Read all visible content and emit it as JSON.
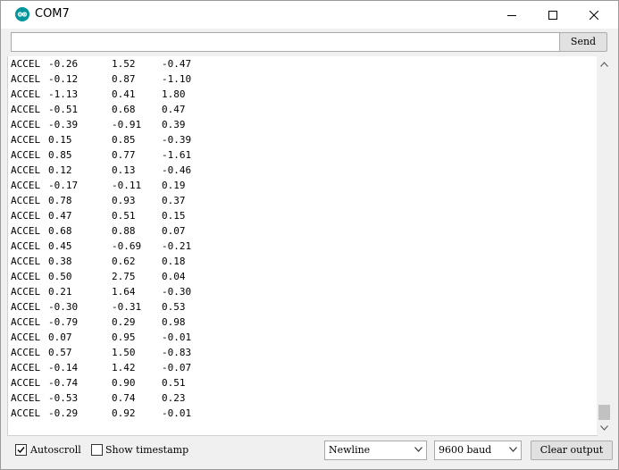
{
  "window": {
    "title": "COM7",
    "icon": "arduino-logo-icon"
  },
  "input": {
    "value": "",
    "placeholder": "",
    "send_label": "Send"
  },
  "output": {
    "lines": [
      [
        "ACCEL",
        "-0.26",
        "1.52",
        "-0.47"
      ],
      [
        "ACCEL",
        "-0.12",
        "0.87",
        "-1.10"
      ],
      [
        "ACCEL",
        "-1.13",
        "0.41",
        "1.80"
      ],
      [
        "ACCEL",
        "-0.51",
        "0.68",
        "0.47"
      ],
      [
        "ACCEL",
        "-0.39",
        "-0.91",
        "0.39"
      ],
      [
        "ACCEL",
        "0.15",
        "0.85",
        "-0.39"
      ],
      [
        "ACCEL",
        "0.85",
        "0.77",
        "-1.61"
      ],
      [
        "ACCEL",
        "0.12",
        "0.13",
        "-0.46"
      ],
      [
        "ACCEL",
        "-0.17",
        "-0.11",
        "0.19"
      ],
      [
        "ACCEL",
        "0.78",
        "0.93",
        "0.37"
      ],
      [
        "ACCEL",
        "0.47",
        "0.51",
        "0.15"
      ],
      [
        "ACCEL",
        "0.68",
        "0.88",
        "0.07"
      ],
      [
        "ACCEL",
        "0.45",
        "-0.69",
        "-0.21"
      ],
      [
        "ACCEL",
        "0.38",
        "0.62",
        "0.18"
      ],
      [
        "ACCEL",
        "0.50",
        "2.75",
        "0.04"
      ],
      [
        "ACCEL",
        "0.21",
        "1.64",
        "-0.30"
      ],
      [
        "ACCEL",
        "-0.30",
        "-0.31",
        "0.53"
      ],
      [
        "ACCEL",
        "-0.79",
        "0.29",
        "0.98"
      ],
      [
        "ACCEL",
        "0.07",
        "0.95",
        "-0.01"
      ],
      [
        "ACCEL",
        "0.57",
        "1.50",
        "-0.83"
      ],
      [
        "ACCEL",
        "-0.14",
        "1.42",
        "-0.07"
      ],
      [
        "ACCEL",
        "-0.74",
        "0.90",
        "0.51"
      ],
      [
        "ACCEL",
        "-0.53",
        "0.74",
        "0.23"
      ],
      [
        "ACCEL",
        "-0.29",
        "0.92",
        "-0.01"
      ]
    ]
  },
  "bottom": {
    "autoscroll_label": "Autoscroll",
    "autoscroll_checked": true,
    "timestamp_label": "Show timestamp",
    "timestamp_checked": false,
    "line_ending": "Newline",
    "baud_rate": "9600 baud",
    "clear_label": "Clear output"
  },
  "colors": {
    "accent": "#00979c"
  }
}
